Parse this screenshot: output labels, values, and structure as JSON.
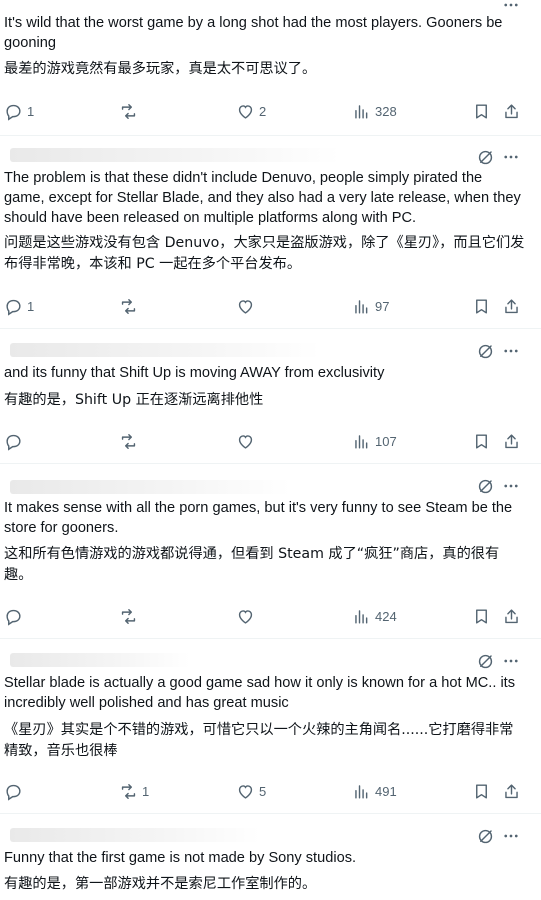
{
  "posts": [
    {
      "text": "It's wild that the worst game by a long shot had the most players. Gooners be gooning",
      "translation": "最差的游戏竟然有最多玩家，真是太不可思议了。",
      "replies": "1",
      "reposts": "",
      "likes": "2",
      "views": "328"
    },
    {
      "text": "The problem is that these didn't include Denuvo, people simply pirated the game, except for Stellar Blade, and they also had a very late release, when they should have been released on multiple platforms along with PC.",
      "translation": "问题是这些游戏没有包含 Denuvo，大家只是盗版游戏，除了《星刃》，而且它们发布得非常晚，本该和 PC 一起在多个平台发布。",
      "replies": "1",
      "reposts": "",
      "likes": "",
      "views": "97"
    },
    {
      "text": "and its funny that Shift Up is moving AWAY from exclusivity",
      "translation": "有趣的是，Shift Up 正在逐渐远离排他性",
      "replies": "",
      "reposts": "",
      "likes": "",
      "views": "107"
    },
    {
      "text": "It makes sense with all the porn games, but it's very funny to see Steam be the store for gooners.",
      "translation": "这和所有色情游戏的游戏都说得通，但看到 Steam 成了“疯狂”商店，真的很有趣。",
      "replies": "",
      "reposts": "",
      "likes": "",
      "views": "424"
    },
    {
      "text": "Stellar blade is actually a good game sad how it only is known for a hot MC.. its incredibly well polished and has great music",
      "translation": "《星刃》其实是个不错的游戏，可惜它只以一个火辣的主角闻名......它打磨得非常精致，音乐也很棒",
      "replies": "",
      "reposts": "1",
      "likes": "5",
      "views": "491"
    },
    {
      "text": "Funny that the first game is not made by Sony studios.",
      "translation": "有趣的是，第一部游戏并不是索尼工作室制作的。"
    }
  ],
  "icons": {
    "reply": "reply-icon",
    "repost": "repost-icon",
    "like": "like-icon",
    "views": "views-icon",
    "bookmark": "bookmark-icon",
    "share": "share-icon",
    "grok": "grok-icon",
    "more": "more-icon"
  },
  "colors": {
    "icon": "#536471",
    "text": "#0f1419",
    "divider": "#eff3f4"
  }
}
